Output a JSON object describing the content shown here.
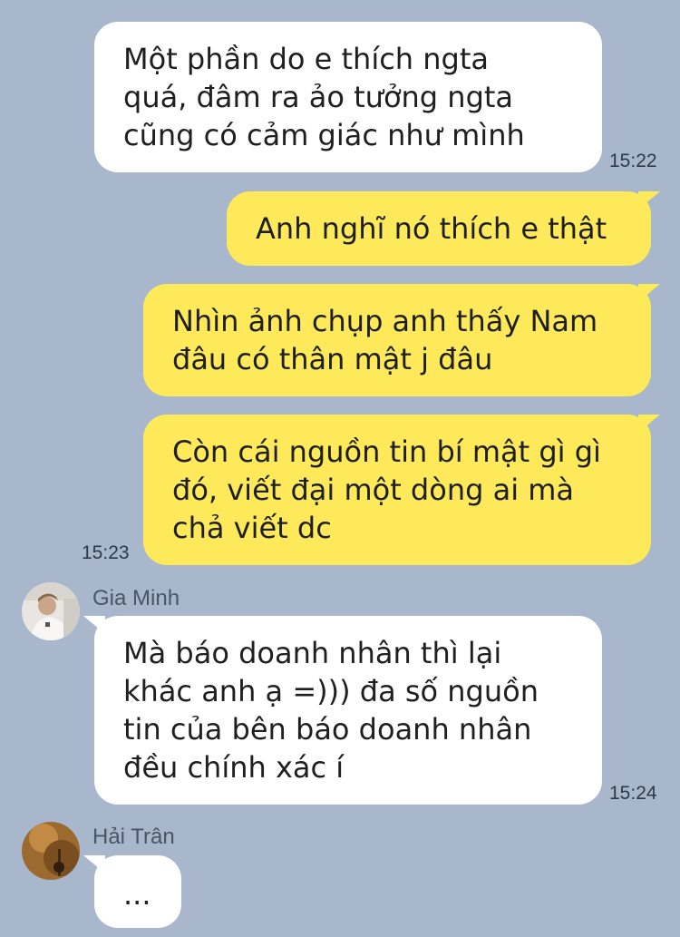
{
  "chat": {
    "messages": [
      {
        "direction": "in",
        "text": "Một phần do e thích ngta\nquá, đâm ra ảo tưởng ngta\ncũng có cảm giác như mình",
        "time": "15:22"
      },
      {
        "direction": "out",
        "text": "Anh nghĩ nó thích e thật"
      },
      {
        "direction": "out",
        "text": "Nhìn ảnh chụp anh thấy Nam\nđâu có thân mật j đâu"
      },
      {
        "direction": "out",
        "text": "Còn cái nguồn tin bí mật gì gì\nđó, viết đại một dòng ai mà\nchả viết dc",
        "time": "15:23"
      },
      {
        "direction": "in",
        "sender": "Gia Minh",
        "text": "Mà báo doanh nhân thì lại\nkhác anh ạ =))) đa số nguồn\ntin của bên báo doanh nhân\nđều chính xác í",
        "time": "15:24"
      },
      {
        "direction": "in",
        "sender": "Hải Trân",
        "text": "..."
      }
    ]
  },
  "colors": {
    "background": "#a8b7cc",
    "incoming_bubble": "#ffffff",
    "outgoing_bubble": "#fde95a"
  },
  "icons": {
    "avatar_gia_minh": "avatar-photo",
    "avatar_hai_tran": "avatar-photo"
  }
}
